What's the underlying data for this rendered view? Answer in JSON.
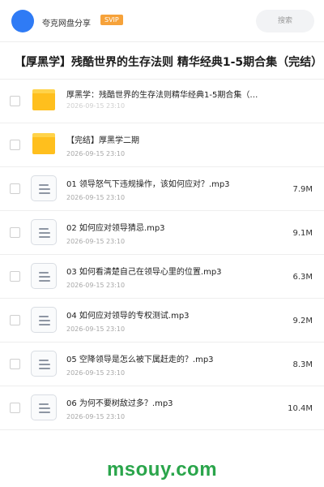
{
  "header": {
    "owner_name": "夸克网盘分享",
    "vip_badge": "SVIP",
    "search_placeholder": "搜索",
    "avatar_color": "#2f7bf5",
    "vip_color": "#f6a23a"
  },
  "share": {
    "title": "【厚黑学】残酷世界的生存法则 精华经典1-5期合集（完结）"
  },
  "files": [
    {
      "type": "folder",
      "name": "厚黑学：残酷世界的生存法则精华经典1-5期合集（…",
      "date": "2026-09-15 23:10",
      "size": ""
    },
    {
      "type": "folder",
      "name": "【完结】厚黑学二期",
      "date": "2026-09-15 23:10",
      "size": ""
    },
    {
      "type": "file",
      "name": "01 领导怒气下违规操作，该如何应对？.mp3",
      "date": "2026-09-15 23:10",
      "size": "7.9M"
    },
    {
      "type": "file",
      "name": "02 如何应对领导猜忌.mp3",
      "date": "2026-09-15 23:10",
      "size": "9.1M"
    },
    {
      "type": "file",
      "name": "03 如何看清楚自己在领导心里的位置.mp3",
      "date": "2026-09-15 23:10",
      "size": "6.3M"
    },
    {
      "type": "file",
      "name": "04 如何应对领导的专权测试.mp3",
      "date": "2026-09-15 23:10",
      "size": "9.2M"
    },
    {
      "type": "file",
      "name": "05 空降领导是怎么被下属赶走的？.mp3",
      "date": "2026-09-15 23:10",
      "size": "8.3M"
    },
    {
      "type": "file",
      "name": "06 为何不要树敌过多？.mp3",
      "date": "2026-09-15 23:10",
      "size": "10.4M"
    }
  ],
  "watermark": "msouy.com",
  "colors": {
    "folder": "#ffbf1d",
    "watermark": "#2aa54b"
  }
}
